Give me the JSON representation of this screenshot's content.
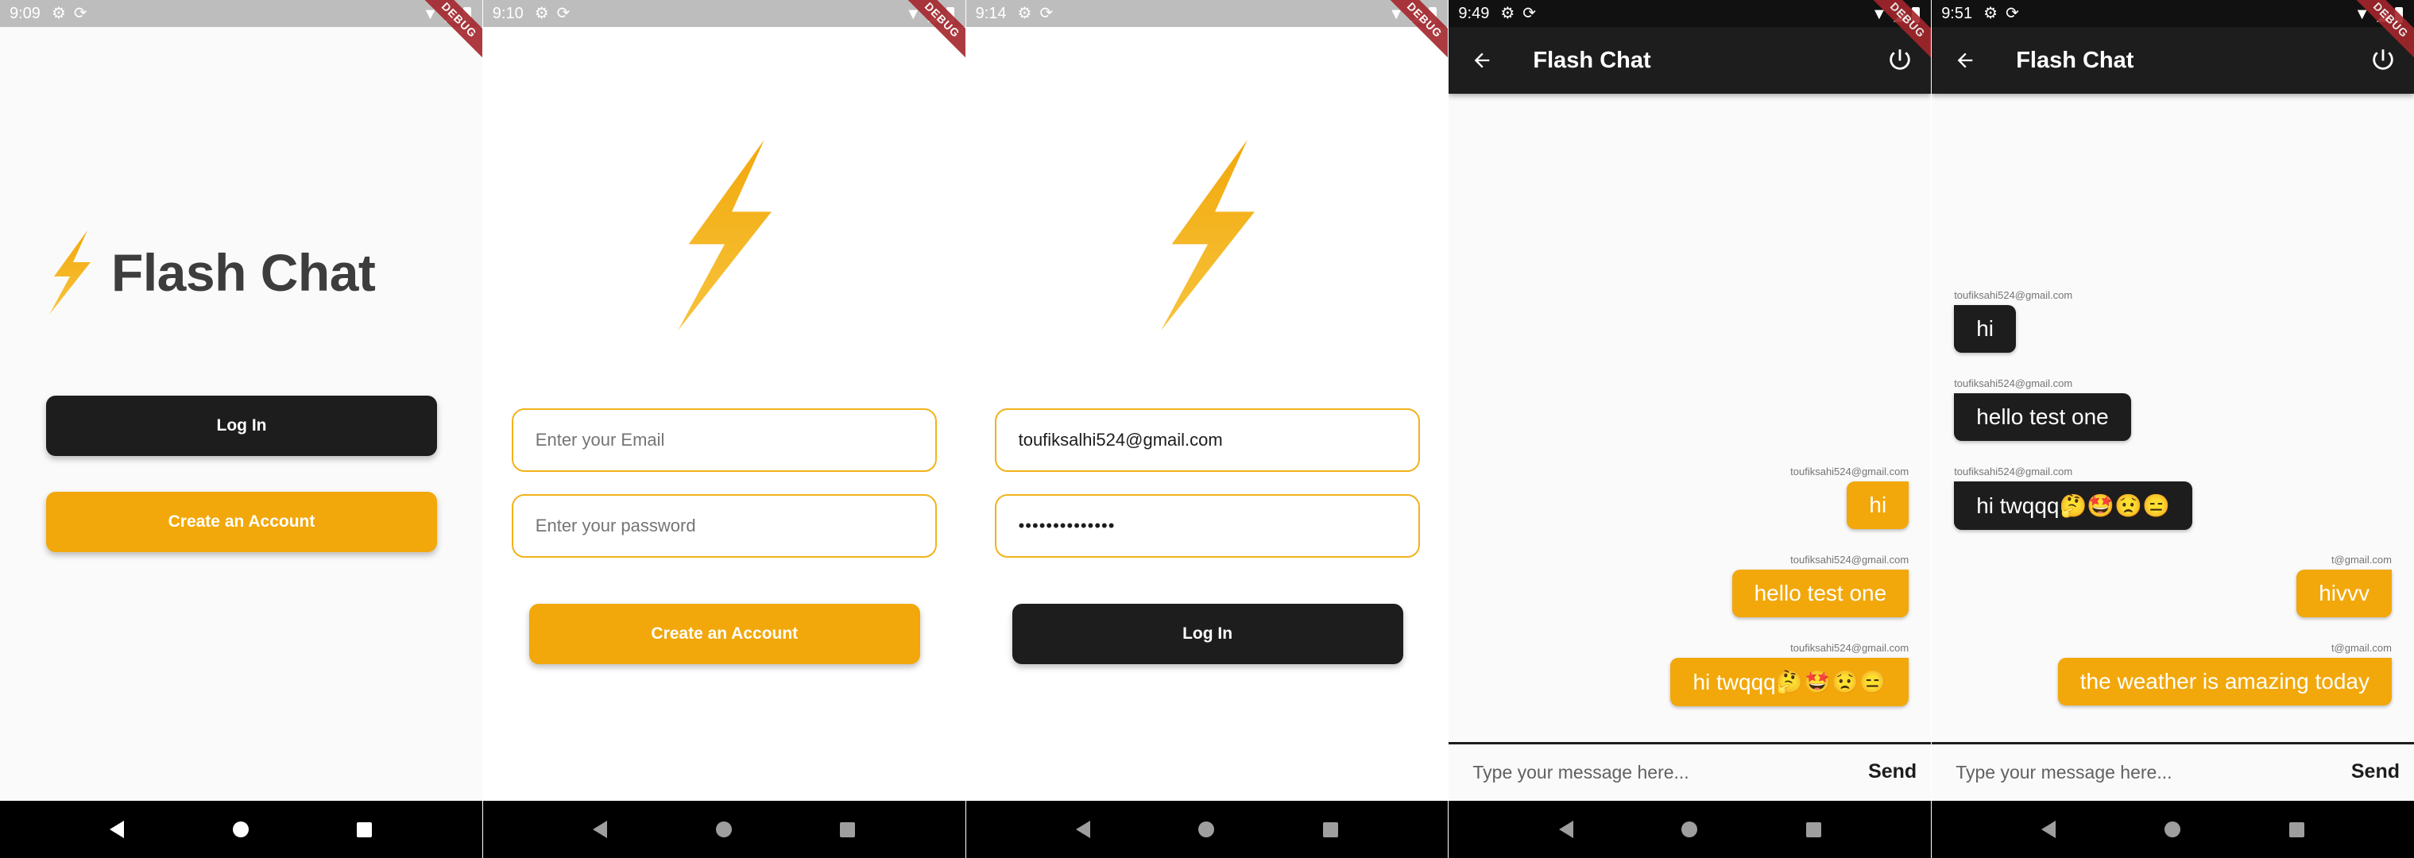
{
  "screens": [
    {
      "status_time": "9:09",
      "debug_label": "DEBUG",
      "brand_title": "Flash Chat",
      "login_label": "Log In",
      "register_label": "Create an Account"
    },
    {
      "status_time": "9:10",
      "debug_label": "DEBUG",
      "email_placeholder": "Enter your Email",
      "password_placeholder": "Enter your password",
      "register_label": "Create an Account"
    },
    {
      "status_time": "9:14",
      "debug_label": "DEBUG",
      "email_value": "toufiksalhi524@gmail.com",
      "password_value": "••••••••••••••",
      "login_label": "Log In"
    },
    {
      "status_time": "9:49",
      "debug_label": "DEBUG",
      "app_title": "Flash Chat",
      "messages": [
        {
          "sender": "toufiksahi524@gmail.com",
          "text": "hi"
        },
        {
          "sender": "toufiksahi524@gmail.com",
          "text": "hello test one"
        },
        {
          "sender": "toufiksahi524@gmail.com",
          "text": "hi twqqq🤔🤩😟😑"
        }
      ],
      "composer_placeholder": "Type your message here...",
      "send_label": "Send"
    },
    {
      "status_time": "9:51",
      "debug_label": "DEBUG",
      "app_title": "Flash Chat",
      "messages": [
        {
          "sender": "toufiksahi524@gmail.com",
          "text": "hi"
        },
        {
          "sender": "toufiksahi524@gmail.com",
          "text": "hello test one"
        },
        {
          "sender": "toufiksahi524@gmail.com",
          "text": "hi twqqq🤔🤩😟😑"
        },
        {
          "sender": "t@gmail.com",
          "text": "hivvv"
        },
        {
          "sender": "t@gmail.com",
          "text": "the weather is amazing today"
        }
      ],
      "composer_placeholder": "Type your message here...",
      "send_label": "Send"
    }
  ],
  "colors": {
    "accent": "#f2a80a",
    "dark": "#1d1d1d",
    "bolt": "#f5b014"
  },
  "icons": [
    "settings-icon",
    "sync-icon",
    "wifi-icon",
    "signal-icon",
    "battery-icon",
    "bolt-icon",
    "back-arrow-icon",
    "power-icon",
    "nav-back-icon",
    "nav-home-icon",
    "nav-recents-icon"
  ]
}
